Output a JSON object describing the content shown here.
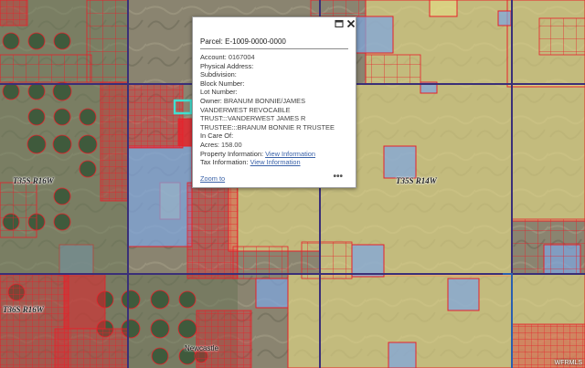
{
  "popup": {
    "title": "Parcel: E-1009-0000-0000",
    "fields": {
      "account_label": "Account:",
      "account_value": "0167004",
      "physical_address_label": "Physical Address:",
      "physical_address_value": "",
      "subdivision_label": "Subdivision:",
      "subdivision_value": "",
      "block_label": "Block Number:",
      "block_value": "",
      "lot_label": "Lot Number:",
      "lot_value": "",
      "owner_label": "Owner:",
      "owner_value": "BRANUM BONNIE/JAMES VANDERWEST REVOCABLE TRUST:::VANDERWEST JAMES R TRUSTEE:::BRANUM BONNIE R TRUSTEE",
      "care_of_label": "In Care Of:",
      "care_of_value": "",
      "acres_label": "Acres:",
      "acres_value": "158.00",
      "property_info_label": "Property Information:",
      "property_info_link": "View Information",
      "tax_info_label": "Tax Information:",
      "tax_info_link": "View Information"
    },
    "zoom_label": "Zoom to",
    "more_label": "•••"
  },
  "map_labels": {
    "t35s_r16w": "T35S R16W",
    "t35s_r14w": "T35S R14W",
    "t36s_r16w": "T36S R16W",
    "newcastle": "Newcastle"
  },
  "attribution": "WFRMLS",
  "colors": {
    "terrain": "#8a8470",
    "farmland": "#707d5e",
    "parcel_outline": "#e8202a",
    "private_fill": "#e8202a",
    "blm_fill": "#e6dd86",
    "state_fill": "#7ea6e0",
    "section_line": "#3a2f78",
    "highway": "#2a5fb0"
  }
}
